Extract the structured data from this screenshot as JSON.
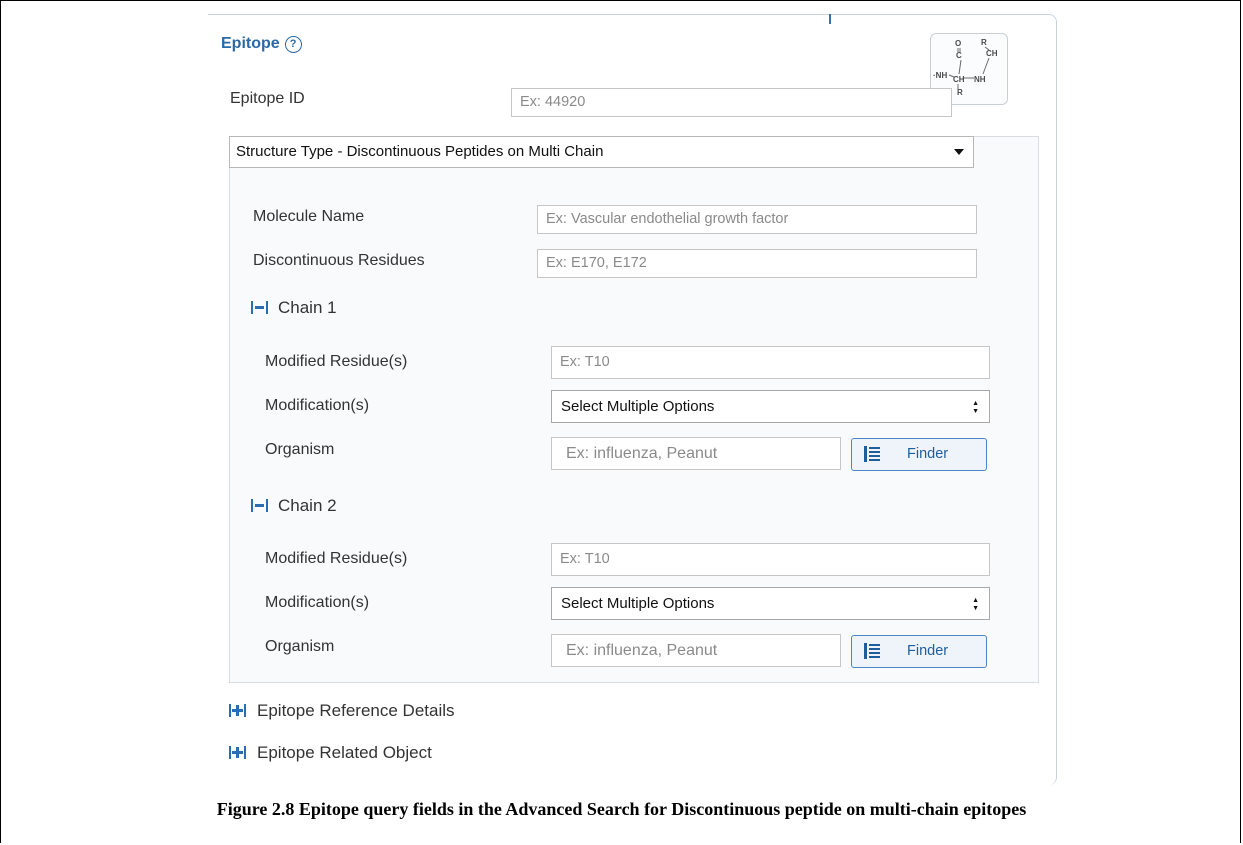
{
  "panel": {
    "title": "Epitope",
    "help_symbol": "?",
    "structure_icon": "peptide-structure-icon",
    "epitope_id": {
      "label": "Epitope ID",
      "placeholder": "Ex: 44920"
    },
    "structure_type": {
      "selected": "Structure Type - Discontinuous Peptides on Multi Chain"
    },
    "molecule_name": {
      "label": "Molecule Name",
      "placeholder": "Ex: Vascular endothelial growth factor"
    },
    "discontinuous_residues": {
      "label": "Discontinuous Residues",
      "placeholder": "Ex: E170, E172"
    },
    "chains": [
      {
        "title": "Chain 1",
        "modified_residues": {
          "label": "Modified Residue(s)",
          "placeholder": "Ex: T10"
        },
        "modifications": {
          "label": "Modification(s)",
          "selected": "Select Multiple Options"
        },
        "organism": {
          "label": "Organism",
          "placeholder": "Ex: influenza, Peanut",
          "button": "Finder"
        }
      },
      {
        "title": "Chain 2",
        "modified_residues": {
          "label": "Modified Residue(s)",
          "placeholder": "Ex: T10"
        },
        "modifications": {
          "label": "Modification(s)",
          "selected": "Select Multiple Options"
        },
        "organism": {
          "label": "Organism",
          "placeholder": "Ex: influenza, Peanut",
          "button": "Finder"
        }
      }
    ],
    "expanders": [
      "Epitope Reference Details",
      "Epitope Related Object"
    ]
  },
  "caption": "Figure 2.8  Epitope query fields in the Advanced Search for Discontinuous peptide on multi-chain epitopes",
  "colors": {
    "accent": "#2b6aa6",
    "icon_blue": "#2a6db3"
  }
}
